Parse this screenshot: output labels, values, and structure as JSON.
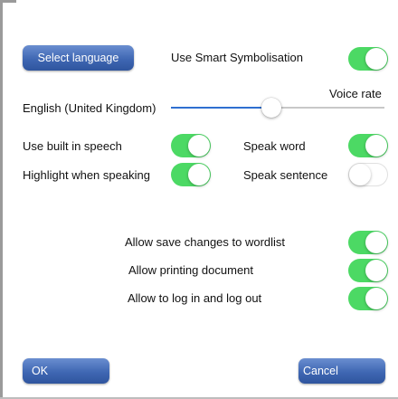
{
  "buttons": {
    "select_language": "Select language",
    "ok": "OK",
    "cancel": "Cancel"
  },
  "settings": {
    "smart_symbolisation": {
      "label": "Use Smart Symbolisation",
      "on": true
    },
    "language": "English (United Kingdom)",
    "voice_rate": {
      "label": "Voice rate",
      "value_fraction": 0.47
    },
    "built_in_speech": {
      "label": "Use built in speech",
      "on": true
    },
    "highlight_speaking": {
      "label": "Highlight when speaking",
      "on": true
    },
    "speak_word": {
      "label": "Speak word",
      "on": true
    },
    "speak_sentence": {
      "label": "Speak sentence",
      "on": false
    },
    "save_wordlist": {
      "label": "Allow save changes to wordlist",
      "on": true
    },
    "printing": {
      "label": "Allow printing document",
      "on": true
    },
    "login_logout": {
      "label": "Allow to log in and log out",
      "on": true
    }
  },
  "colors": {
    "toggle_on": "#4cd964",
    "button_blue": "#3f67b3",
    "slider_fill": "#2f6fd0"
  }
}
